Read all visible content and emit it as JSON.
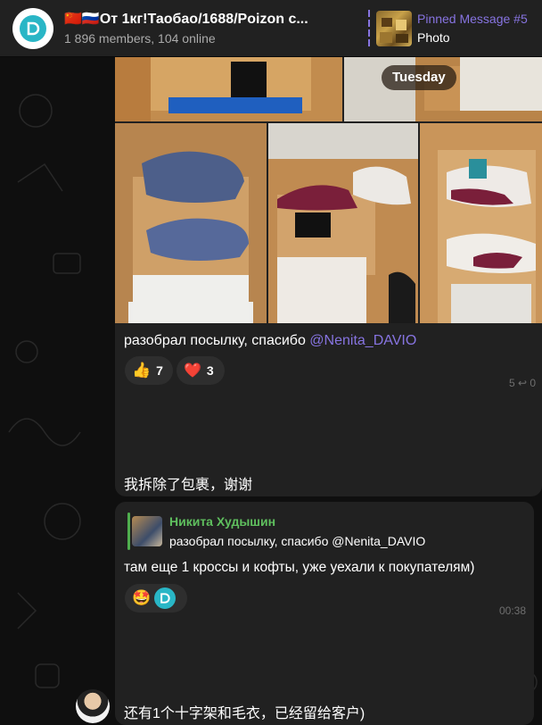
{
  "header": {
    "title": "🇨🇳🇷🇺От 1кг!Таобао/1688/Poizon с...",
    "subtitle": "1 896 members, 104 online",
    "pinned_title": "Pinned Message #5",
    "pinned_text": "Photo"
  },
  "album": {
    "day_chip": "Tuesday",
    "caption_text": "разобрал посылку, спасибо ",
    "caption_mention": "@Nenita_DAVIO",
    "reactions": [
      {
        "emoji": "👍",
        "count": "7"
      },
      {
        "emoji": "❤️",
        "count": "3"
      }
    ],
    "meta": "5 ↩ 0"
  },
  "msg_cn1": {
    "text": "我拆除了包裹，谢谢"
  },
  "reply_msg": {
    "reply_name": "Никита Худышин",
    "reply_text": "разобрал посылку, спасибо @Nenita_DAVIO",
    "text": "там еще 1 кроссы и кофты, уже уехали к покупателям)",
    "time": "00:38"
  },
  "msg_cn2": {
    "text": "还有1个十字架和毛衣，已经留给客户)"
  },
  "colors": {
    "accent": "#8774e1",
    "reply": "#5fbf5e",
    "bubble": "#212121"
  }
}
